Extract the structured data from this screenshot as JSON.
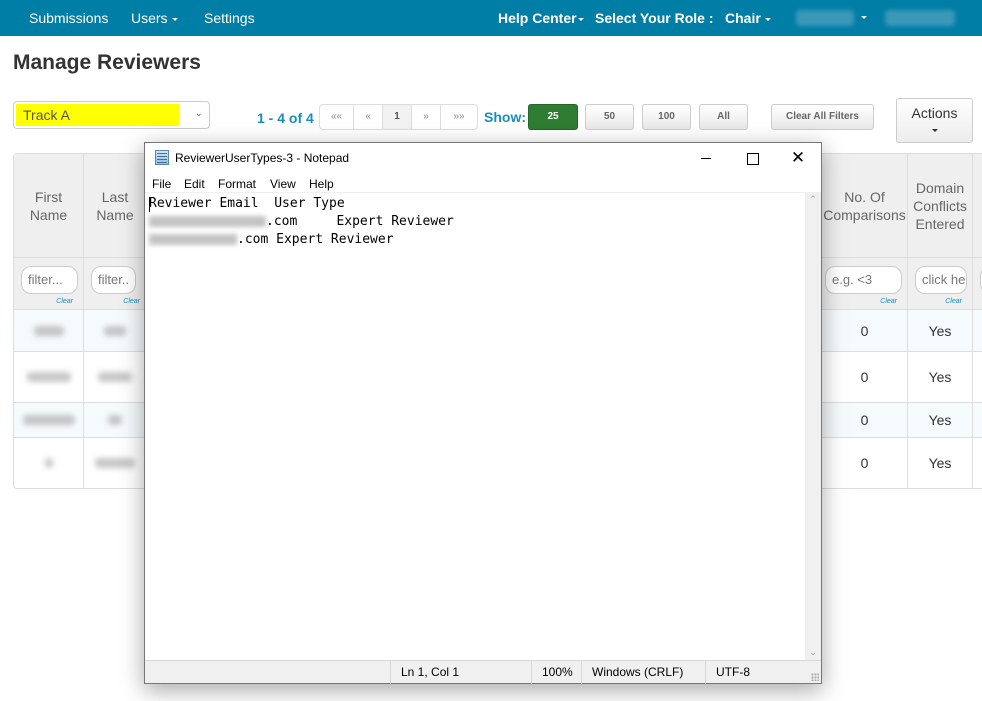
{
  "topnav": {
    "items": [
      {
        "label": "Submissions",
        "dropdown": false
      },
      {
        "label": "Users",
        "dropdown": true
      },
      {
        "label": "Settings",
        "dropdown": false
      }
    ],
    "help_center": "Help Center",
    "role_label": "Select Your Role :",
    "role_value": "Chair"
  },
  "page": {
    "title": "Manage Reviewers"
  },
  "toolbar": {
    "track_value": "Track A",
    "record_count": "1 - 4 of 4",
    "pager": [
      "««",
      "«",
      "1",
      "»",
      "»»"
    ],
    "pager_active": "1",
    "show_label": "Show:",
    "page_sizes": [
      "25",
      "50",
      "100",
      "All"
    ],
    "page_size_active": "25",
    "clear_filters_label": "Clear All Filters",
    "actions_label": "Actions"
  },
  "table": {
    "columns": {
      "first_name": {
        "header": "First Name",
        "filter_placeholder": "filter...",
        "clear": "Clear"
      },
      "last_name": {
        "header": "Last Name",
        "filter_placeholder": "filter..",
        "clear": "Clear"
      },
      "comparisons": {
        "header": "No. Of Comparisons",
        "filter_placeholder": "e.g. <3",
        "clear": "Clear"
      },
      "domain_conflicts": {
        "header": "Domain Conflicts Entered",
        "filter_placeholder": "click here",
        "clear": "Clear"
      }
    },
    "rows": [
      {
        "comparisons": "0",
        "domain_conflicts": "Yes"
      },
      {
        "comparisons": "0",
        "domain_conflicts": "Yes"
      },
      {
        "comparisons": "0",
        "domain_conflicts": "Yes"
      },
      {
        "comparisons": "0",
        "domain_conflicts": "Yes"
      }
    ]
  },
  "notepad": {
    "title": "ReviewerUserTypes-3 - Notepad",
    "menu": [
      "File",
      "Edit",
      "Format",
      "View",
      "Help"
    ],
    "lines": [
      {
        "prefix": "",
        "text": "Reviewer Email  User Type"
      },
      {
        "prefix": "[redacted]",
        "text": ".com     Expert Reviewer"
      },
      {
        "prefix": "[redacted]",
        "text": ".com Expert Reviewer"
      }
    ],
    "status": {
      "position": "Ln 1, Col 1",
      "zoom": "100%",
      "line_ending": "Windows (CRLF)",
      "encoding": "UTF-8"
    }
  },
  "colors": {
    "nav_bg": "#017ea6",
    "accent_text": "#1a8dbd",
    "active_page_size": "#2e7d32",
    "track_highlight": "#ffff00"
  }
}
